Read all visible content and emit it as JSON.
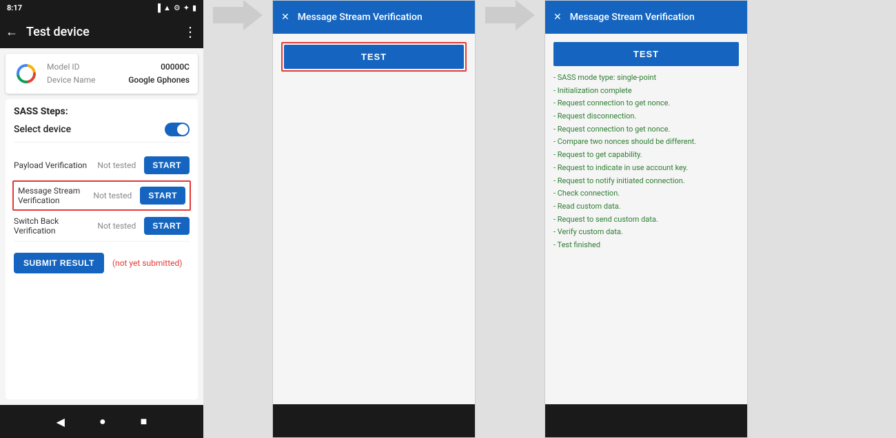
{
  "phone": {
    "status_bar": {
      "time": "8:17",
      "icons": [
        "sim",
        "wifi",
        "settings",
        "bluetooth",
        "battery"
      ]
    },
    "toolbar": {
      "back_label": "←",
      "title": "Test device",
      "menu_label": "⋮"
    },
    "device_info": {
      "model_id_label": "Model ID",
      "model_id_value": "00000C",
      "device_name_label": "Device Name",
      "device_name_value": "Google Gphones"
    },
    "sass": {
      "title": "SASS Steps:",
      "select_device_label": "Select device",
      "rows": [
        {
          "label": "Payload Verification",
          "status": "Not tested",
          "button": "START"
        },
        {
          "label": "Message Stream\nVerification",
          "status": "Not tested",
          "button": "START",
          "highlighted": true
        },
        {
          "label": "Switch Back Verification",
          "status": "Not tested",
          "button": "START"
        }
      ],
      "submit_button": "SUBMIT RESULT",
      "not_submitted_label": "(not yet submitted)"
    },
    "nav": {
      "back": "◀",
      "home": "●",
      "recent": "■"
    }
  },
  "dialog1": {
    "close_label": "✕",
    "title": "Message Stream Verification",
    "test_button_label": "TEST"
  },
  "dialog2": {
    "close_label": "✕",
    "title": "Message Stream Verification",
    "test_button_label": "TEST",
    "results": [
      "- SASS mode type: single-point",
      "- Initialization complete",
      "- Request connection to get nonce.",
      "- Request disconnection.",
      "- Request connection to get nonce.",
      "- Compare two nonces should be different.",
      "- Request to get capability.",
      "- Request to indicate in use account key.",
      "- Request to notify initiated connection.",
      "- Check connection.",
      "- Read custom data.",
      "- Request to send custom data.",
      "- Verify custom data.",
      "- Test finished"
    ]
  }
}
